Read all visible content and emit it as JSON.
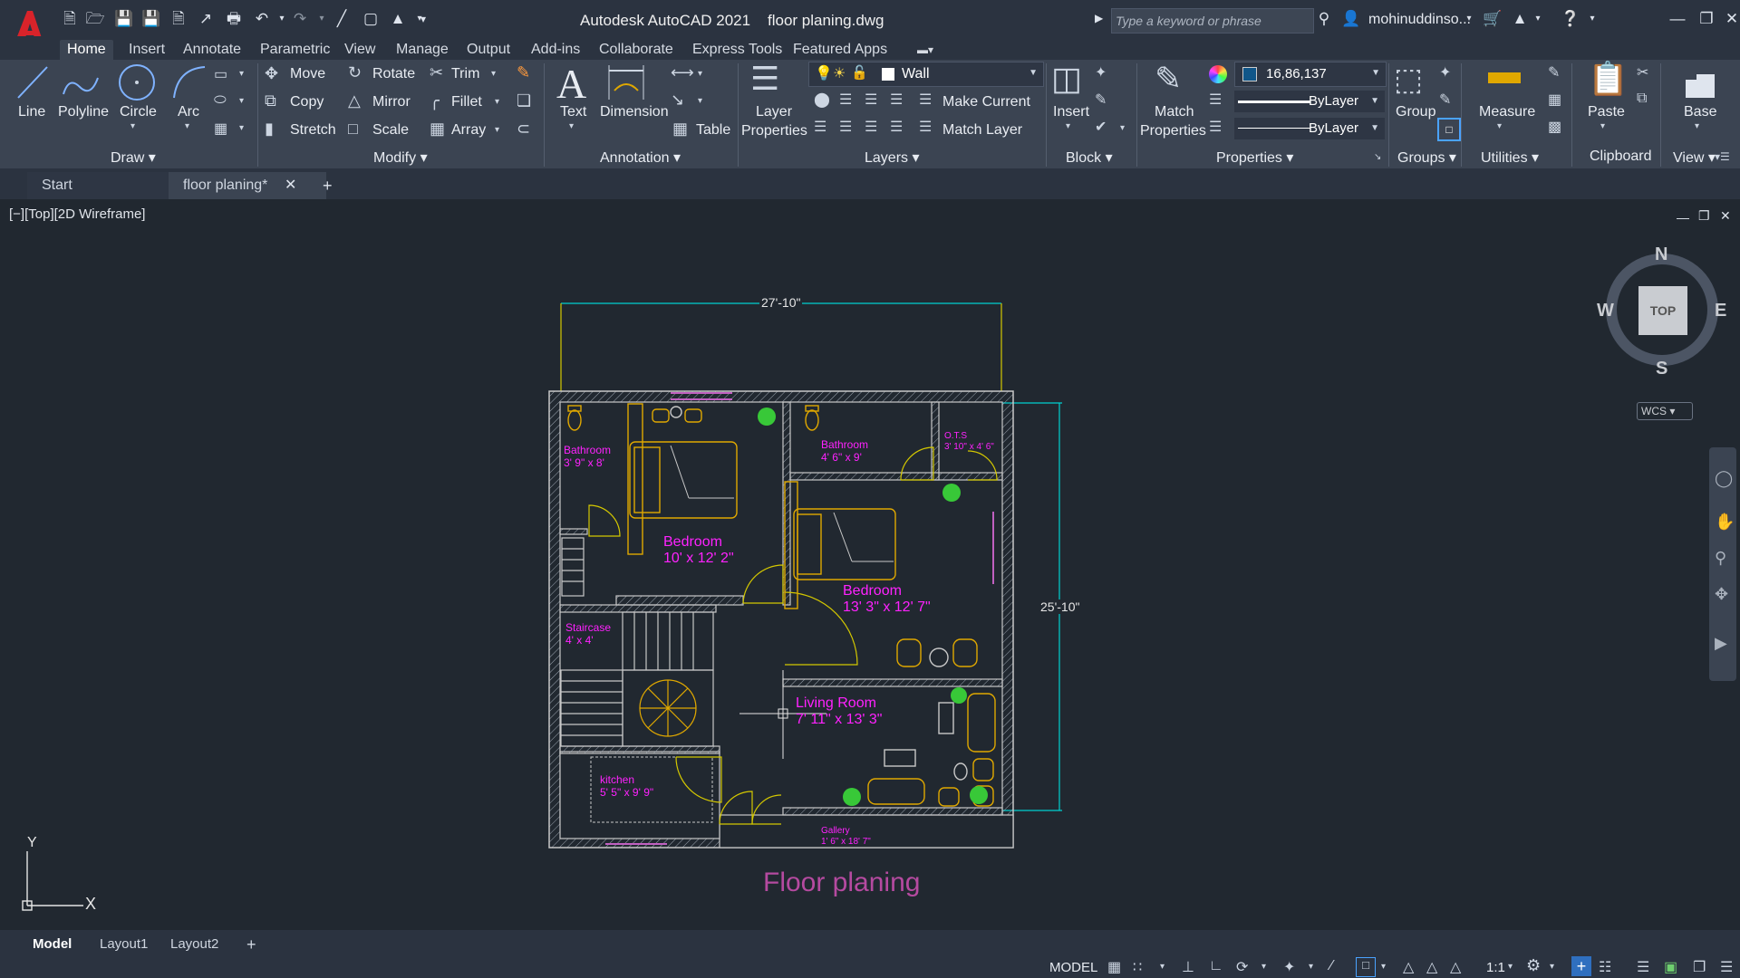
{
  "titlebar": {
    "app": "Autodesk AutoCAD 2021",
    "file": "floor planing.dwg",
    "search_placeholder": "Type a keyword or phrase",
    "user": "mohinuddinso..."
  },
  "ribbon_tabs": [
    "Home",
    "Insert",
    "Annotate",
    "Parametric",
    "View",
    "Manage",
    "Output",
    "Add-ins",
    "Collaborate",
    "Express Tools",
    "Featured Apps"
  ],
  "draw": {
    "line": "Line",
    "polyline": "Polyline",
    "circle": "Circle",
    "arc": "Arc",
    "title": "Draw"
  },
  "modify": {
    "move": "Move",
    "rotate": "Rotate",
    "trim": "Trim",
    "copy": "Copy",
    "mirror": "Mirror",
    "fillet": "Fillet",
    "stretch": "Stretch",
    "scale": "Scale",
    "array": "Array",
    "title": "Modify"
  },
  "annotation": {
    "text": "Text",
    "dimension": "Dimension",
    "table": "Table",
    "title": "Annotation"
  },
  "layers": {
    "properties_l1": "Layer",
    "properties_l2": "Properties",
    "current_layer": "Wall",
    "make_current": "Make Current",
    "match_layer": "Match Layer",
    "title": "Layers"
  },
  "block": {
    "insert": "Insert",
    "title": "Block"
  },
  "properties": {
    "match_l1": "Match",
    "match_l2": "Properties",
    "color": "16,86,137",
    "linetype": "ByLayer",
    "lineweight": "ByLayer",
    "title": "Properties"
  },
  "groups": {
    "group": "Group",
    "title": "Groups"
  },
  "utilities": {
    "measure": "Measure",
    "title": "Utilities"
  },
  "clipboard": {
    "paste": "Paste",
    "title": "Clipboard"
  },
  "view_panel": {
    "base": "Base",
    "title": "View"
  },
  "doc_tabs": {
    "start": "Start",
    "active": "floor planing*"
  },
  "viewport_label": "[−][Top][2D Wireframe]",
  "viewcube": {
    "n": "N",
    "s": "S",
    "e": "E",
    "w": "W",
    "top": "TOP",
    "wcs": "WCS"
  },
  "drawing": {
    "title": "Floor planing",
    "dim_top": "27'-10\"",
    "dim_right": "25'-10\"",
    "rooms": [
      {
        "name": "Bathroom",
        "size": "3' 9\" x 8'"
      },
      {
        "name": "Bedroom",
        "size": "10' x 12' 2\""
      },
      {
        "name": "Bathroom",
        "size": "4' 6\" x 9'"
      },
      {
        "name": "O.T.S",
        "size": "3' 10\" x 4' 6\""
      },
      {
        "name": "Bedroom",
        "size": "13' 3\" x 12' 7\""
      },
      {
        "name": "Staircase",
        "size": "4' x 4'"
      },
      {
        "name": "Living Room",
        "size": "7' 11\" x 13' 3\""
      },
      {
        "name": "kitchen",
        "size": "5' 5\" x 9' 9\""
      },
      {
        "name": "Gallery",
        "size": "1' 6\" x 18' 7\""
      }
    ]
  },
  "ucs": {
    "x": "X",
    "y": "Y"
  },
  "layout_tabs": [
    "Model",
    "Layout1",
    "Layout2"
  ],
  "status": {
    "model": "MODEL",
    "scale": "1:1"
  },
  "colors": {
    "wall": "#c8c8c8",
    "furniture": "#e0a800",
    "labels": "#ff22ff",
    "dimension": "#00d0d0",
    "title": "#b54aa0"
  }
}
